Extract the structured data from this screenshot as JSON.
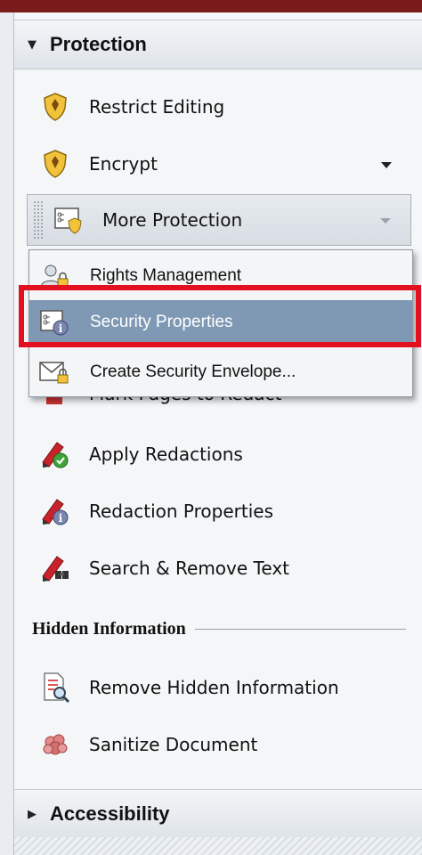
{
  "protection": {
    "header": "Protection",
    "items": {
      "restrict_editing": "Restrict Editing",
      "encrypt": "Encrypt",
      "more_protection": "More Protection"
    },
    "redaction_items": {
      "mark_pages": "Mark Pages to Redact",
      "apply_redactions": "Apply Redactions",
      "redaction_properties": "Redaction Properties",
      "search_remove": "Search & Remove Text"
    }
  },
  "more_protection_menu": {
    "rights_management": "Rights Management",
    "security_properties": "Security Properties",
    "create_security_envelope": "Create Security Envelope..."
  },
  "hidden_information": {
    "header": "Hidden Information",
    "remove_hidden": "Remove Hidden Information",
    "sanitize": "Sanitize Document"
  },
  "accessibility": {
    "header": "Accessibility"
  },
  "colors": {
    "selected_bg": "#7f99b4",
    "highlight_border": "#e3101f",
    "shield": "#f2c33a"
  },
  "icons": {
    "restrict_editing": "shield-icon",
    "encrypt": "shield-icon",
    "more_protection": "security-list-icon",
    "rights_management": "user-lock-icon",
    "security_properties": "security-info-icon",
    "create_security_envelope": "envelope-lock-icon",
    "apply_redactions": "redaction-check-icon",
    "redaction_properties": "redaction-info-icon",
    "search_remove": "redaction-search-icon",
    "remove_hidden": "document-search-icon",
    "sanitize": "sanitize-icon"
  }
}
